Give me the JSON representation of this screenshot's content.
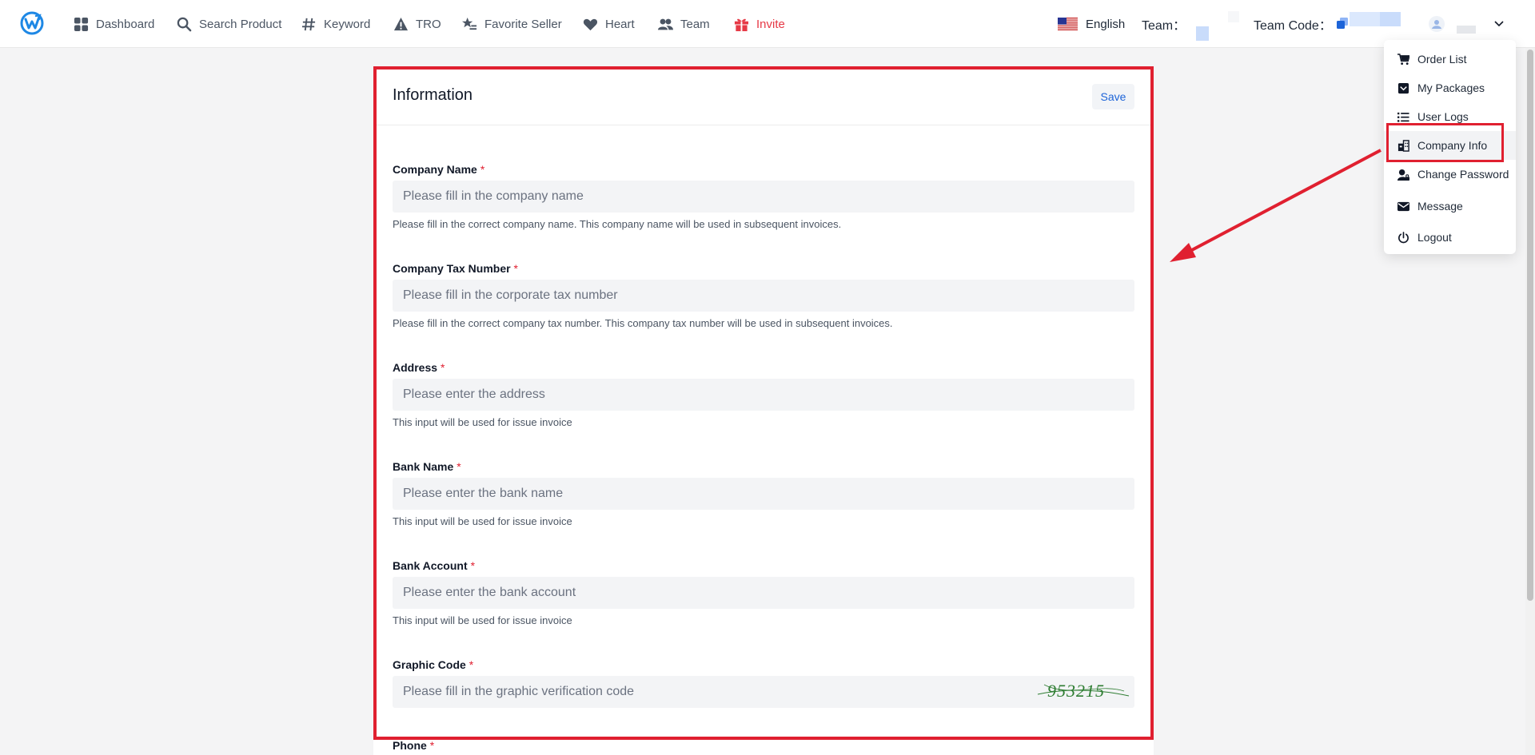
{
  "nav": {
    "items": [
      {
        "label": "Dashboard",
        "icon": "grid-icon"
      },
      {
        "label": "Search Product",
        "icon": "search-icon"
      },
      {
        "label": "Keyword",
        "icon": "hash-icon"
      },
      {
        "label": "TRO",
        "icon": "warning-icon"
      },
      {
        "label": "Favorite Seller",
        "icon": "star-list-icon"
      },
      {
        "label": "Heart",
        "icon": "heart-icon"
      },
      {
        "label": "Team",
        "icon": "team-icon"
      },
      {
        "label": "Invite",
        "icon": "gift-icon",
        "color": "#e63946"
      }
    ],
    "language": "English",
    "team_label": "Team：",
    "team_code_label": "Team Code："
  },
  "menu": {
    "items": [
      {
        "label": "Order List",
        "icon": "cart-icon"
      },
      {
        "label": "My Packages",
        "icon": "package-icon"
      },
      {
        "label": "User Logs",
        "icon": "list-icon"
      },
      {
        "label": "Company Info",
        "icon": "building-icon",
        "active": true
      },
      {
        "label": "Change Password",
        "icon": "user-lock-icon"
      },
      {
        "label": "Message",
        "icon": "mail-icon"
      },
      {
        "label": "Logout",
        "icon": "power-icon"
      }
    ]
  },
  "form": {
    "title": "Information",
    "save_label": "Save",
    "fields": [
      {
        "label": "Company Name",
        "required": "*",
        "placeholder": "Please fill in the company name",
        "hint": "Please fill in the correct company name. This company name will be used in subsequent invoices."
      },
      {
        "label": "Company Tax Number",
        "required": "*",
        "placeholder": "Please fill in the corporate tax number",
        "hint": "Please fill in the correct company tax number. This company tax number will be used in subsequent invoices."
      },
      {
        "label": "Address",
        "required": "*",
        "placeholder": "Please enter the address",
        "hint": "This input will be used for issue invoice"
      },
      {
        "label": "Bank Name",
        "required": "*",
        "placeholder": "Please enter the bank name",
        "hint": "This input will be used for issue invoice"
      },
      {
        "label": "Bank Account",
        "required": "*",
        "placeholder": "Please enter the bank account",
        "hint": "This input will be used for issue invoice"
      },
      {
        "label": "Graphic Code",
        "required": "*",
        "placeholder": "Please fill in the graphic verification code",
        "captcha": "953215"
      },
      {
        "label": "Phone",
        "required": "*"
      }
    ]
  },
  "colors": {
    "accent": "#1d64d8",
    "highlight": "#e02030",
    "invite": "#e63946",
    "captcha": "#2e7d32"
  }
}
